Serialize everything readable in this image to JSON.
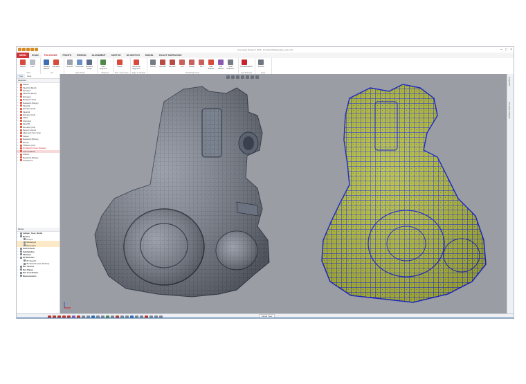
{
  "app": {
    "title": "Geomagic Design X 2016 - [C:\\Users\\Data\\engine_scan.xrl]"
  },
  "ribbon": {
    "tabs": [
      {
        "label": "MENU",
        "state": "file"
      },
      {
        "label": "SCAN",
        "state": "normal"
      },
      {
        "label": "POLYGONS",
        "state": "active"
      },
      {
        "label": "POINTS",
        "state": "normal"
      },
      {
        "label": "REGION",
        "state": "normal"
      },
      {
        "label": "ALIGNMENT",
        "state": "normal"
      },
      {
        "label": "SKETCH",
        "state": "normal"
      },
      {
        "label": "3D SKETCH",
        "state": "normal"
      },
      {
        "label": "MODEL",
        "state": "normal"
      },
      {
        "label": "EXACT SURFACING",
        "state": "normal"
      }
    ],
    "groups": [
      {
        "label": "Tool",
        "buttons": [
          {
            "label": "Repair",
            "color": "#d84a3b"
          },
          {
            "label": "Free",
            "color": "#b7bcc4"
          }
        ]
      },
      {
        "label": "Fit",
        "buttons": [
          {
            "label": "Healing Wizard",
            "color": "#3b6fb3"
          },
          {
            "label": "Fill Holes",
            "color": "#d84a3b"
          }
        ]
      },
      {
        "label": "Edit Tools",
        "buttons": [
          {
            "label": "Smooth",
            "color": "#9aa3ad"
          },
          {
            "label": "Decimate",
            "color": "#6b8fc7"
          },
          {
            "label": "Enhance Shape",
            "color": "#5b6d8a"
          }
        ]
      },
      {
        "label": "Regions",
        "buttons": [
          {
            "label": "Auto Segment",
            "color": "#4d8a4a"
          }
        ]
      },
      {
        "label": "Ref. Geometry",
        "buttons": [
          {
            "label": "Plane",
            "color": "#d84a3b"
          }
        ]
      },
      {
        "label": "Align to Global",
        "buttons": [
          {
            "label": "Interactive Alignment",
            "color": "#d84a3b"
          }
        ]
      },
      {
        "label": "Modeling Tools",
        "buttons": [
          {
            "label": "Sketch",
            "color": "#777d86"
          },
          {
            "label": "Extrude",
            "color": "#b84b45"
          },
          {
            "label": "Revolve",
            "color": "#b84b45"
          },
          {
            "label": "Loft",
            "color": "#c9605a"
          },
          {
            "label": "Sweep",
            "color": "#c9605a"
          },
          {
            "label": "Trim",
            "color": "#c9605a"
          },
          {
            "label": "Auto Surface",
            "color": "#d84a3b"
          },
          {
            "label": "Loft Wizard",
            "color": "#8a5ab0"
          },
          {
            "label": "Solid Problems",
            "color": "#777d86"
          }
        ]
      },
      {
        "label": "LiveTransfer",
        "buttons": [
          {
            "label": "SOLIDWORKS",
            "color": "#c8232c"
          }
        ]
      },
      {
        "label": "Help",
        "buttons": [
          {
            "label": "Tutorial",
            "color": "#6e7781"
          }
        ]
      }
    ]
  },
  "feature_panel": {
    "tabs": [
      "Tree",
      "Help"
    ],
    "title": "Features",
    "items": [
      {
        "label": "Plane1",
        "state": ""
      },
      {
        "label": "Sketch1 (Mesh)",
        "state": ""
      },
      {
        "label": "Extrude1",
        "state": ""
      },
      {
        "label": "Sketch2 (Mesh)",
        "state": ""
      },
      {
        "label": "Extrude2",
        "state": ""
      },
      {
        "label": "Boolean1 (Cut)",
        "state": ""
      },
      {
        "label": "Boolean2 (Merge)",
        "state": ""
      },
      {
        "label": "Sketch3",
        "state": ""
      },
      {
        "label": "Extrude3 (Cut)",
        "state": ""
      },
      {
        "label": "Sketch4",
        "state": ""
      },
      {
        "label": "Extrude4 (Cut)",
        "state": ""
      },
      {
        "label": "Fillet1",
        "state": ""
      },
      {
        "label": "Chamfer1",
        "state": ""
      },
      {
        "label": "Sketch5",
        "state": ""
      },
      {
        "label": "Extrude5 (Cut)",
        "state": ""
      },
      {
        "label": "Region Group1",
        "state": ""
      },
      {
        "label": "Alignment from Scan",
        "state": ""
      },
      {
        "label": "Plane2",
        "state": ""
      },
      {
        "label": "Boolean3 (Merge)",
        "state": ""
      },
      {
        "label": "Mirror1",
        "state": ""
      },
      {
        "label": "Thicken1 (3.0)",
        "state": ""
      },
      {
        "label": "3D Sketch1 (Auto Surface)",
        "state": "warn"
      },
      {
        "label": "Auto Surface1",
        "state": "sel"
      },
      {
        "label": "Offset1",
        "state": ""
      },
      {
        "label": "Boolean4 (Merge)",
        "state": ""
      },
      {
        "label": "Transform1",
        "state": ""
      }
    ]
  },
  "model_panel": {
    "title": "Model",
    "items": [
      {
        "label": "Calliper_Scan_Model",
        "level": 0,
        "bold": true,
        "state": ""
      },
      {
        "label": "Meshes",
        "level": 0,
        "bold": true,
        "state": ""
      },
      {
        "label": "Group1",
        "level": 1,
        "bold": false,
        "state": ""
      },
      {
        "label": "Subsample",
        "level": 1,
        "bold": false,
        "state": "hl"
      },
      {
        "label": "Remeshed",
        "level": 1,
        "bold": false,
        "state": "hl"
      },
      {
        "label": "Point Clouds",
        "level": 0,
        "bold": true,
        "state": ""
      },
      {
        "label": "Solid Bodies",
        "level": 0,
        "bold": true,
        "state": ""
      },
      {
        "label": "Sketches",
        "level": 0,
        "bold": true,
        "state": ""
      },
      {
        "label": "3D Sketches",
        "level": 0,
        "bold": true,
        "state": ""
      },
      {
        "label": "3D Sketch1",
        "level": 1,
        "bold": false,
        "state": ""
      },
      {
        "label": "3D Sketch2 (Auto Surface)",
        "level": 1,
        "bold": false,
        "state": ""
      },
      {
        "label": "Ref. Vectors",
        "level": 0,
        "bold": true,
        "state": ""
      },
      {
        "label": "Ref. Planes",
        "level": 0,
        "bold": true,
        "state": ""
      },
      {
        "label": "Ref. Coordinates",
        "level": 0,
        "bold": true,
        "state": ""
      },
      {
        "label": "Measurements",
        "level": 0,
        "bold": true,
        "state": ""
      }
    ]
  },
  "viewport": {
    "left_model": "solid mesh engine scan",
    "right_model": "auto surface patch network",
    "background_color": "#9a9da4",
    "mesh_color": "#7d8491",
    "patch_color": "#2633d6",
    "fill_color": "#b9c03a"
  },
  "right_panels": [
    "Properties",
    "Accuracy Analyzer"
  ],
  "bottom_bar": {
    "view_label": "Model View"
  },
  "icons": [
    "repair-icon",
    "healing-wizard-icon",
    "fill-holes-icon",
    "smooth-icon",
    "auto-segment-icon",
    "plane-icon",
    "interactive-alignment-icon",
    "sketch-icon",
    "extrude-icon",
    "revolve-icon",
    "loft-icon",
    "auto-surface-icon",
    "solidworks-icon",
    "tutorial-icon",
    "feature-icon",
    "folder-icon",
    "axis-triad-icon"
  ]
}
